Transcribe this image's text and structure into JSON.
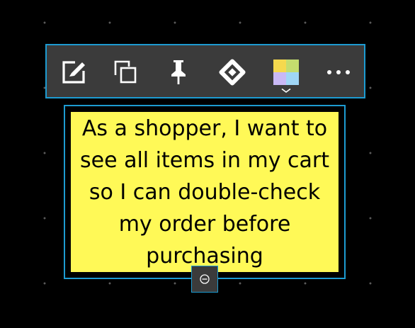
{
  "toolbar": {
    "buttons": [
      {
        "name": "edit",
        "icon": "edit-icon"
      },
      {
        "name": "duplicate",
        "icon": "duplicate-icon"
      },
      {
        "name": "pin",
        "icon": "pin-icon"
      },
      {
        "name": "jira",
        "icon": "jira-icon"
      },
      {
        "name": "color",
        "icon": "color-palette-icon"
      },
      {
        "name": "more",
        "icon": "more-icon"
      }
    ],
    "palette_colors": [
      "#f5d94e",
      "#c4dd6e",
      "#c9b8f5",
      "#9fd6f6"
    ]
  },
  "sticky_note": {
    "text": "As a shopper, I want to see all items in my cart so I can double-check my order before purchasing",
    "color": "#fff957"
  },
  "colors": {
    "selection": "#1d9bd1",
    "toolbar_bg": "#3b3b3b",
    "canvas_bg": "#000000"
  }
}
